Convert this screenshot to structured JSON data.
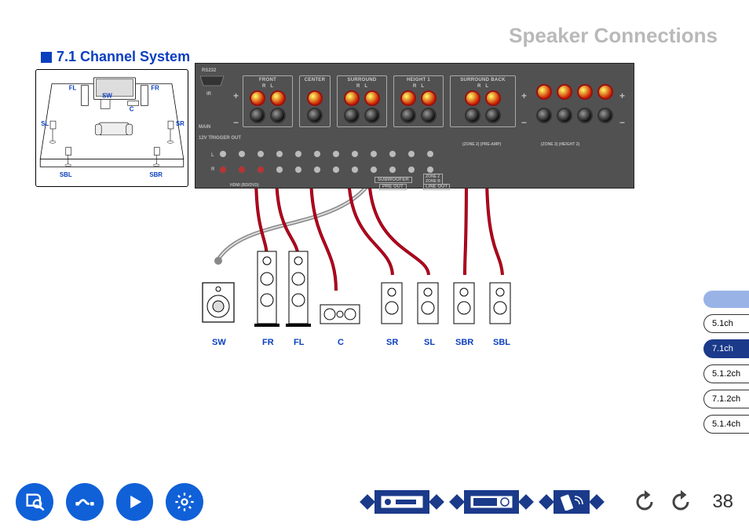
{
  "header": "Speaker Connections",
  "section_title": "7.1 Channel System",
  "room": {
    "labels": {
      "FL": "FL",
      "FR": "FR",
      "SW": "SW",
      "C": "C",
      "SL": "SL",
      "SR": "SR",
      "SBL": "SBL",
      "SBR": "SBR"
    }
  },
  "amp": {
    "groups": [
      {
        "label": "FRONT",
        "sub": [
          "R",
          "L"
        ]
      },
      {
        "label": "CENTER",
        "sub": [
          ""
        ]
      },
      {
        "label": "SURROUND",
        "sub": [
          "R",
          "L"
        ]
      },
      {
        "label": "HEIGHT 1",
        "sub": [
          "R",
          "L"
        ]
      },
      {
        "label": "SURROUND BACK",
        "sub": [
          "R",
          "L"
        ]
      }
    ],
    "misc": {
      "rs232": "RS232",
      "ir": "IR",
      "main": "MAIN",
      "trigger": "12V TRIGGER OUT",
      "zone_preamp": "(ZONE 2) (PRE-AMP)",
      "zone_height": "(ZONE 3) (HEIGHT 2)",
      "subwoofer": "SUBWOOFER",
      "preout": "PRE OUT",
      "zone2zoneb": "ZONE 2\nZONE B",
      "lineout": "LINE OUT",
      "plugs_lr": "L",
      "plugs_r": "R",
      "hdmi_bd": "HDMI (BD/DVD)"
    }
  },
  "speaker_labels": [
    "SW",
    "FR",
    "FL",
    "C",
    "SR",
    "SL",
    "SBR",
    "SBL"
  ],
  "ch_nav": [
    "5.1ch",
    "7.1ch",
    "5.1.2ch",
    "7.1.2ch",
    "5.1.4ch"
  ],
  "ch_nav_active": "7.1ch",
  "nav_icons": [
    "manual-search",
    "cables",
    "play",
    "settings"
  ],
  "dev_icons": [
    "receiver-front",
    "receiver-display",
    "remote"
  ],
  "page_number": "38"
}
